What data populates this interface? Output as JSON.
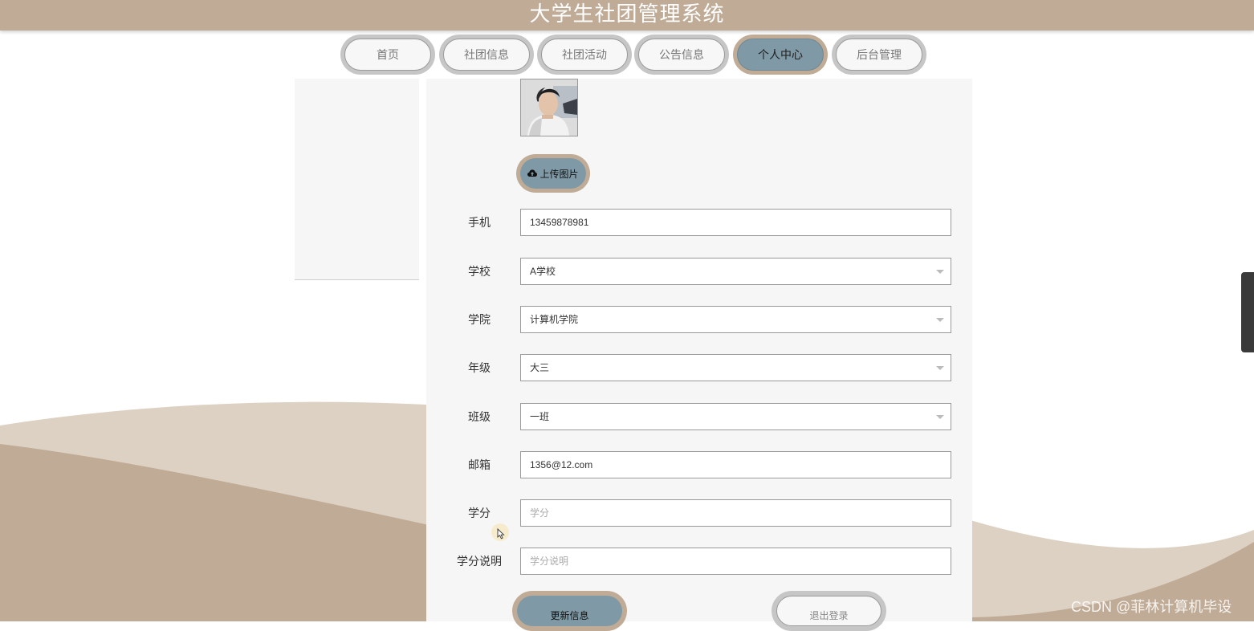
{
  "app": {
    "title": "大学生社团管理系统"
  },
  "nav": {
    "items": [
      {
        "label": "首页"
      },
      {
        "label": "社团信息"
      },
      {
        "label": "社团活动"
      },
      {
        "label": "公告信息"
      },
      {
        "label": "个人中心",
        "active": true
      },
      {
        "label": "后台管理"
      }
    ]
  },
  "profile": {
    "upload_label": "上传图片",
    "fields": {
      "phone": {
        "label": "手机",
        "value": "13459878981"
      },
      "school": {
        "label": "学校",
        "value": "A学校"
      },
      "college": {
        "label": "学院",
        "value": "计算机学院"
      },
      "grade": {
        "label": "年级",
        "value": "大三"
      },
      "class": {
        "label": "班级",
        "value": "一班"
      },
      "email": {
        "label": "邮箱",
        "value": "1356@12.com"
      },
      "credit": {
        "label": "学分",
        "placeholder": "学分"
      },
      "credit_desc": {
        "label": "学分说明",
        "placeholder": "学分说明"
      }
    },
    "update_label": "更新信息",
    "logout_label": "退出登录"
  },
  "watermark": "CSDN @菲林计算机毕设",
  "colors": {
    "brand": "#c0ab96",
    "accent": "#7f9aa6",
    "wave_light": "#ddd1c3"
  }
}
